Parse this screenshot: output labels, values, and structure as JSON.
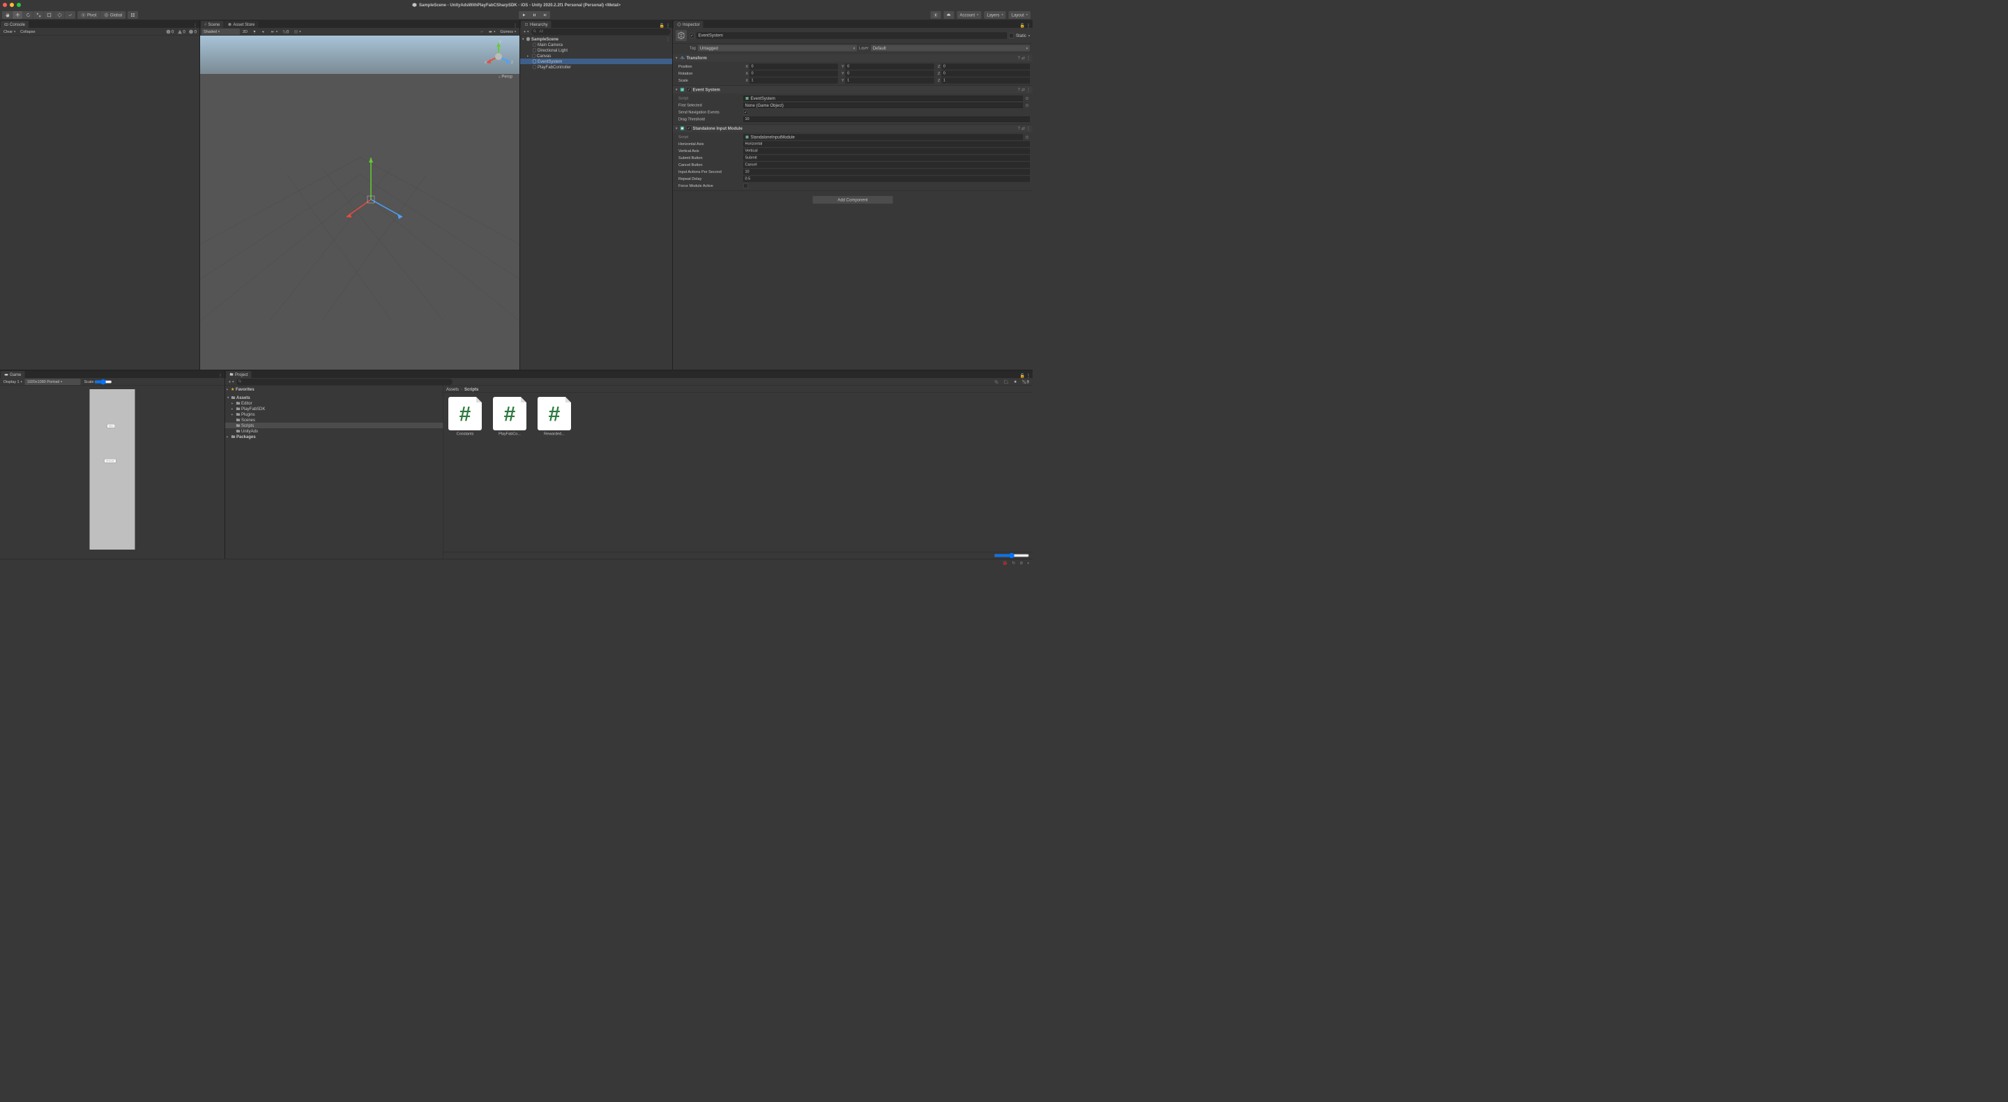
{
  "title": "SampleScene - UnityAdsWithPlayFabCSharpSDK - iOS - Unity 2020.2.2f1 Personal (Personal) <Metal>",
  "toolbar": {
    "pivot": "Pivot",
    "global": "Global",
    "account": "Account",
    "layers": "Layers",
    "layout": "Layout"
  },
  "console": {
    "tab": "Console",
    "clear": "Clear",
    "collapse": "Collapse",
    "err": "0",
    "warn": "0",
    "info": "0"
  },
  "scene": {
    "tab": "Scene",
    "asset_store_tab": "Asset Store",
    "shading": "Shaded",
    "mode2d": "2D",
    "gizmos": "Gizmos",
    "persp": "Persp",
    "axis_x": "x",
    "axis_y": "y",
    "axis_z": "z",
    "hidden_zero": "0"
  },
  "hierarchy": {
    "tab": "Hierarchy",
    "search_placeholder": "All",
    "scene_name": "SampleScene",
    "items": [
      "Main Camera",
      "Directional Light",
      "Canvas",
      "EventSystem",
      "PlayFabController"
    ]
  },
  "inspector": {
    "tab": "Inspector",
    "static": "Static",
    "go_name": "EventSystem",
    "tag_label": "Tag",
    "tag_value": "Untagged",
    "layer_label": "Layer",
    "layer_value": "Default",
    "transform": {
      "title": "Transform",
      "position": "Position",
      "rotation": "Rotation",
      "scale": "Scale",
      "px": "0",
      "py": "0",
      "pz": "0",
      "rx": "0",
      "ry": "0",
      "rz": "0",
      "sx": "1",
      "sy": "1",
      "sz": "1"
    },
    "eventsystem": {
      "title": "Event System",
      "script_label": "Script",
      "script_val": "EventSystem",
      "first_selected_label": "First Selected",
      "first_selected_val": "None (Game Object)",
      "send_nav_label": "Send Navigation Events",
      "drag_threshold_label": "Drag Threshold",
      "drag_threshold_val": "10"
    },
    "input_module": {
      "title": "Standalone Input Module",
      "script_label": "Script",
      "script_val": "StandaloneInputModule",
      "h_axis_label": "Horizontal Axis",
      "h_axis_val": "Horizontal",
      "v_axis_label": "Vertical Axis",
      "v_axis_val": "Vertical",
      "submit_label": "Submit Button",
      "submit_val": "Submit",
      "cancel_label": "Cancel Button",
      "cancel_val": "Cancel",
      "actions_label": "Input Actions Per Second",
      "actions_val": "10",
      "repeat_label": "Repeat Delay",
      "repeat_val": "0.5",
      "force_label": "Force Module Active"
    },
    "add_component": "Add Component"
  },
  "game": {
    "tab": "Game",
    "display": "Display 1",
    "resolution": "1920x1080 Portrait",
    "scale_label": "Scale",
    "btn1": "Reload",
    "btn2": "Get Reward!!"
  },
  "project": {
    "tab": "Project",
    "hidden_count": "9",
    "favorites": "Favorites",
    "assets": "Assets",
    "folders": [
      "Editor",
      "PlayFabSDK",
      "Plugins",
      "Scenes",
      "Scripts",
      "UnityAds"
    ],
    "packages": "Packages",
    "breadcrumb": [
      "Assets",
      "Scripts"
    ],
    "items": [
      "Constants",
      "PlayFabCo...",
      "Rewarded..."
    ]
  }
}
